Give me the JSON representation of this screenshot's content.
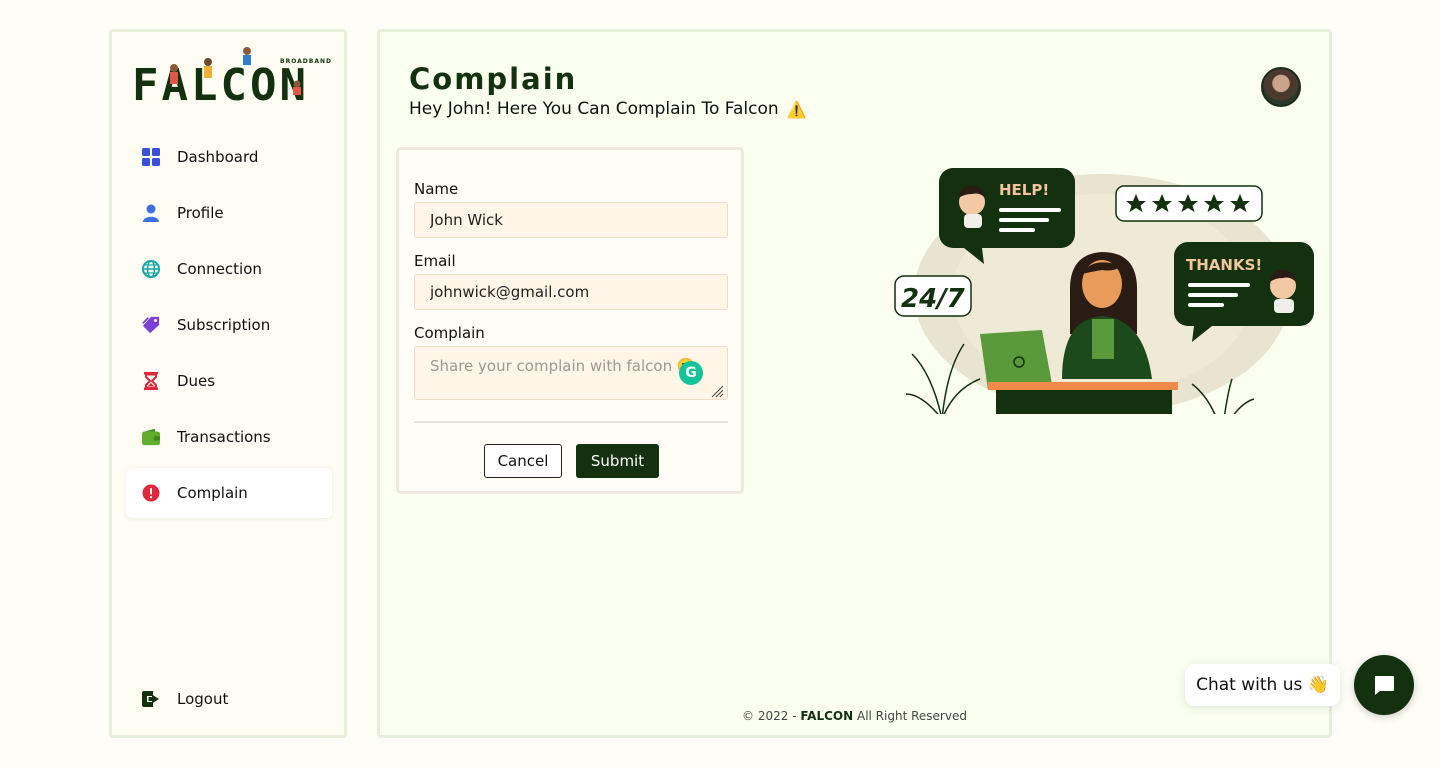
{
  "brand": {
    "name": "FALCON",
    "tagline": "BROADBAND"
  },
  "sidebar": {
    "items": [
      {
        "label": "Dashboard",
        "icon": "grid-icon",
        "color": "#3b4fd9"
      },
      {
        "label": "Profile",
        "icon": "user-icon",
        "color": "#3b6fe0"
      },
      {
        "label": "Connection",
        "icon": "globe-icon",
        "color": "#14a8a8"
      },
      {
        "label": "Subscription",
        "icon": "tag-icon",
        "color": "#7b3fd6"
      },
      {
        "label": "Dues",
        "icon": "hourglass-icon",
        "color": "#e0283a"
      },
      {
        "label": "Transactions",
        "icon": "wallet-icon",
        "color": "#5fae2e"
      },
      {
        "label": "Complain",
        "icon": "alert-icon",
        "color": "#e0283a",
        "active": true
      }
    ],
    "logout": {
      "label": "Logout",
      "icon": "logout-icon"
    }
  },
  "header": {
    "title": "Complain",
    "subtitle": "Hey John! Here You Can Complain To Falcon",
    "warning_icon": "⚠️"
  },
  "form": {
    "name_label": "Name",
    "name_value": "John Wick",
    "email_label": "Email",
    "email_value": "johnwick@gmail.com",
    "complain_label": "Complain",
    "complain_placeholder": "Share your complain with falcon 🙂",
    "cancel_label": "Cancel",
    "submit_label": "Submit"
  },
  "illustration": {
    "help_text": "HELP!",
    "thanks_text": "THANKS!",
    "availability_text": "24/7",
    "rating_stars": 5
  },
  "footer": {
    "prefix": "© 2022 - ",
    "brand": "FALCON",
    "suffix": " All Right Reserved"
  },
  "chat": {
    "label": "Chat with us 👋"
  },
  "colors": {
    "primary": "#13300f",
    "accent": "#f08a4b",
    "background": "#fefdf6"
  }
}
